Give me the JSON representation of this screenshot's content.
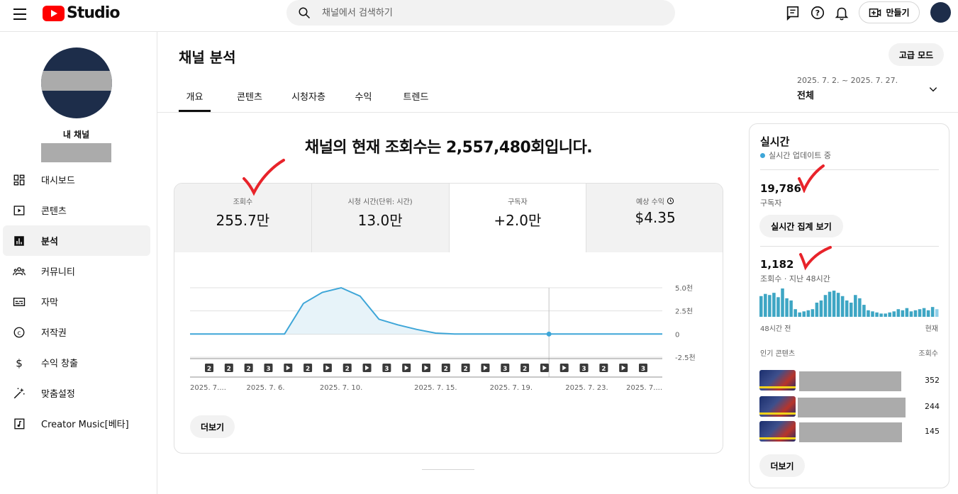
{
  "header": {
    "logo_text": "Studio",
    "search_placeholder": "채널에서 검색하기",
    "create_label": "만들기"
  },
  "sidebar": {
    "channel_label": "내 채널",
    "items": [
      {
        "label": "대시보드",
        "icon": "dashboard-icon"
      },
      {
        "label": "콘텐츠",
        "icon": "content-icon"
      },
      {
        "label": "분석",
        "icon": "analytics-icon",
        "active": true
      },
      {
        "label": "커뮤니티",
        "icon": "community-icon"
      },
      {
        "label": "자막",
        "icon": "subtitles-icon"
      },
      {
        "label": "저작권",
        "icon": "copyright-icon"
      },
      {
        "label": "수익 창출",
        "icon": "dollar-icon"
      },
      {
        "label": "맞춤설정",
        "icon": "magic-wand-icon"
      },
      {
        "label": "Creator Music[베타]",
        "icon": "music-icon"
      }
    ]
  },
  "page": {
    "title": "채널 분석",
    "advanced_mode": "고급 모드",
    "tabs": [
      "개요",
      "콘텐츠",
      "시청자층",
      "수익",
      "트렌드"
    ],
    "active_tab": 0,
    "date_range": "2025. 7. 2. ~ 2025. 7. 27.",
    "date_scope": "전체"
  },
  "headline": {
    "prefix": "채널의 현재 조회수는 ",
    "value": "2,557,480",
    "suffix": "회입니다."
  },
  "metrics": [
    {
      "label": "조회수",
      "value": "255.7만"
    },
    {
      "label": "시청 시간(단위: 시간)",
      "value": "13.0만"
    },
    {
      "label": "구독자",
      "value": "+2.0만",
      "active": true
    },
    {
      "label": "예상 수익",
      "value": "$4.35"
    }
  ],
  "chart_data": {
    "type": "area",
    "x": [
      0,
      1,
      2,
      3,
      4,
      5,
      6,
      7,
      8,
      9,
      10,
      11,
      12,
      13,
      14,
      15,
      16,
      17,
      18,
      19,
      20,
      21,
      22,
      23,
      24,
      25
    ],
    "series": [
      {
        "values": [
          0,
          0,
          0,
          0,
          0,
          0,
          3300,
          4500,
          5000,
          4100,
          1600,
          1000,
          500,
          100,
          0,
          0,
          0,
          0,
          0,
          0,
          0,
          0,
          0,
          0,
          0,
          0
        ]
      }
    ],
    "x_tick_labels": [
      "2025. 7....",
      "2025. 7. 6.",
      "2025. 7. 10.",
      "2025. 7. 15.",
      "2025. 7. 19.",
      "2025. 7. 23.",
      "2025. 7...."
    ],
    "x_tick_index": [
      0,
      4,
      8,
      13,
      17,
      21,
      25
    ],
    "y_tick_values": [
      5000,
      2500,
      0,
      -2500
    ],
    "y_tick_labels": [
      "5.0천",
      "2.5천",
      "0",
      "-2.5천"
    ],
    "ylim": [
      -2500,
      5000
    ],
    "highlight_index": 19,
    "upload_markers": [
      "2",
      "2",
      "2",
      "3",
      "▶",
      "2",
      "▶",
      "2",
      "▶",
      "3",
      "▶",
      "▶",
      "2",
      "2",
      "▶",
      "3",
      "2",
      "▶",
      "▶",
      "3",
      "2",
      "▶",
      "3"
    ],
    "grid": true,
    "legend": "none"
  },
  "card_more": "더보기",
  "realtime": {
    "title": "실시간",
    "live_label": "실시간 업데이트 중",
    "subscribers": "19,786",
    "subscribers_label": "구독자",
    "aggregate_button": "실시간 집계 보기",
    "views": "1,182",
    "views_label": "조회수 · 지난 48시간",
    "bars": [
      38,
      42,
      40,
      44,
      36,
      52,
      34,
      30,
      14,
      8,
      10,
      12,
      14,
      26,
      30,
      40,
      46,
      48,
      44,
      38,
      30,
      26,
      40,
      34,
      22,
      12,
      10,
      8,
      6,
      6,
      8,
      10,
      14,
      12,
      16,
      10,
      12,
      14,
      16,
      12,
      18,
      14
    ],
    "axis_left": "48시간 전",
    "axis_right": "현재",
    "top_content_label": "인기 콘텐츠",
    "top_views_label": "조회수",
    "top_items": [
      {
        "views": "352"
      },
      {
        "views": "244"
      },
      {
        "views": "145"
      }
    ],
    "more": "더보기"
  }
}
